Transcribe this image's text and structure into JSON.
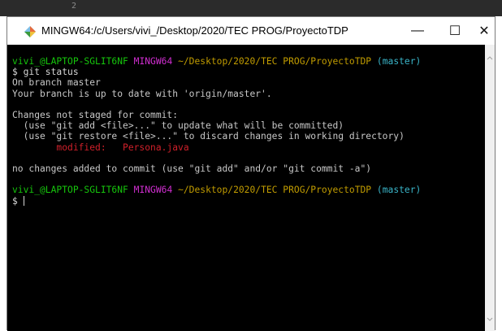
{
  "background_fragment": "2",
  "window": {
    "title": "MINGW64:/c/Users/vivi_/Desktop/2020/TEC PROG/ProyectoTDP",
    "controls": {
      "minimize": "—",
      "maximize": "☐",
      "close": "✕"
    }
  },
  "terminal": {
    "prompt1": {
      "user_host": "vivi_@LAPTOP-SGLIT6NF",
      "env": "MINGW64",
      "path": "~/Desktop/2020/TEC PROG/ProyectoTDP",
      "branch": "(master)"
    },
    "command": "$ git status",
    "output": {
      "on_branch": "On branch master",
      "up_to_date": "Your branch is up to date with 'origin/master'.",
      "changes_header": "Changes not staged for commit:",
      "hint_add": "  (use \"git add <file>...\" to update what will be committed)",
      "hint_restore": "  (use \"git restore <file>...\" to discard changes in working directory)",
      "modified_label": "        modified:   ",
      "modified_file": "Persona.java",
      "no_changes": "no changes added to commit (use \"git add\" and/or \"git commit -a\")"
    },
    "prompt2": {
      "user_host": "vivi_@LAPTOP-SGLIT6NF",
      "env": "MINGW64",
      "path": "~/Desktop/2020/TEC PROG/ProyectoTDP",
      "branch": "(master)"
    },
    "input_prompt": "$ "
  },
  "colors": {
    "user_host": "#16c60c",
    "env": "#d12ed1",
    "path": "#c19c00",
    "branch": "#3ab5c9",
    "modified": "#d0202a",
    "text": "#c8c8c8"
  }
}
